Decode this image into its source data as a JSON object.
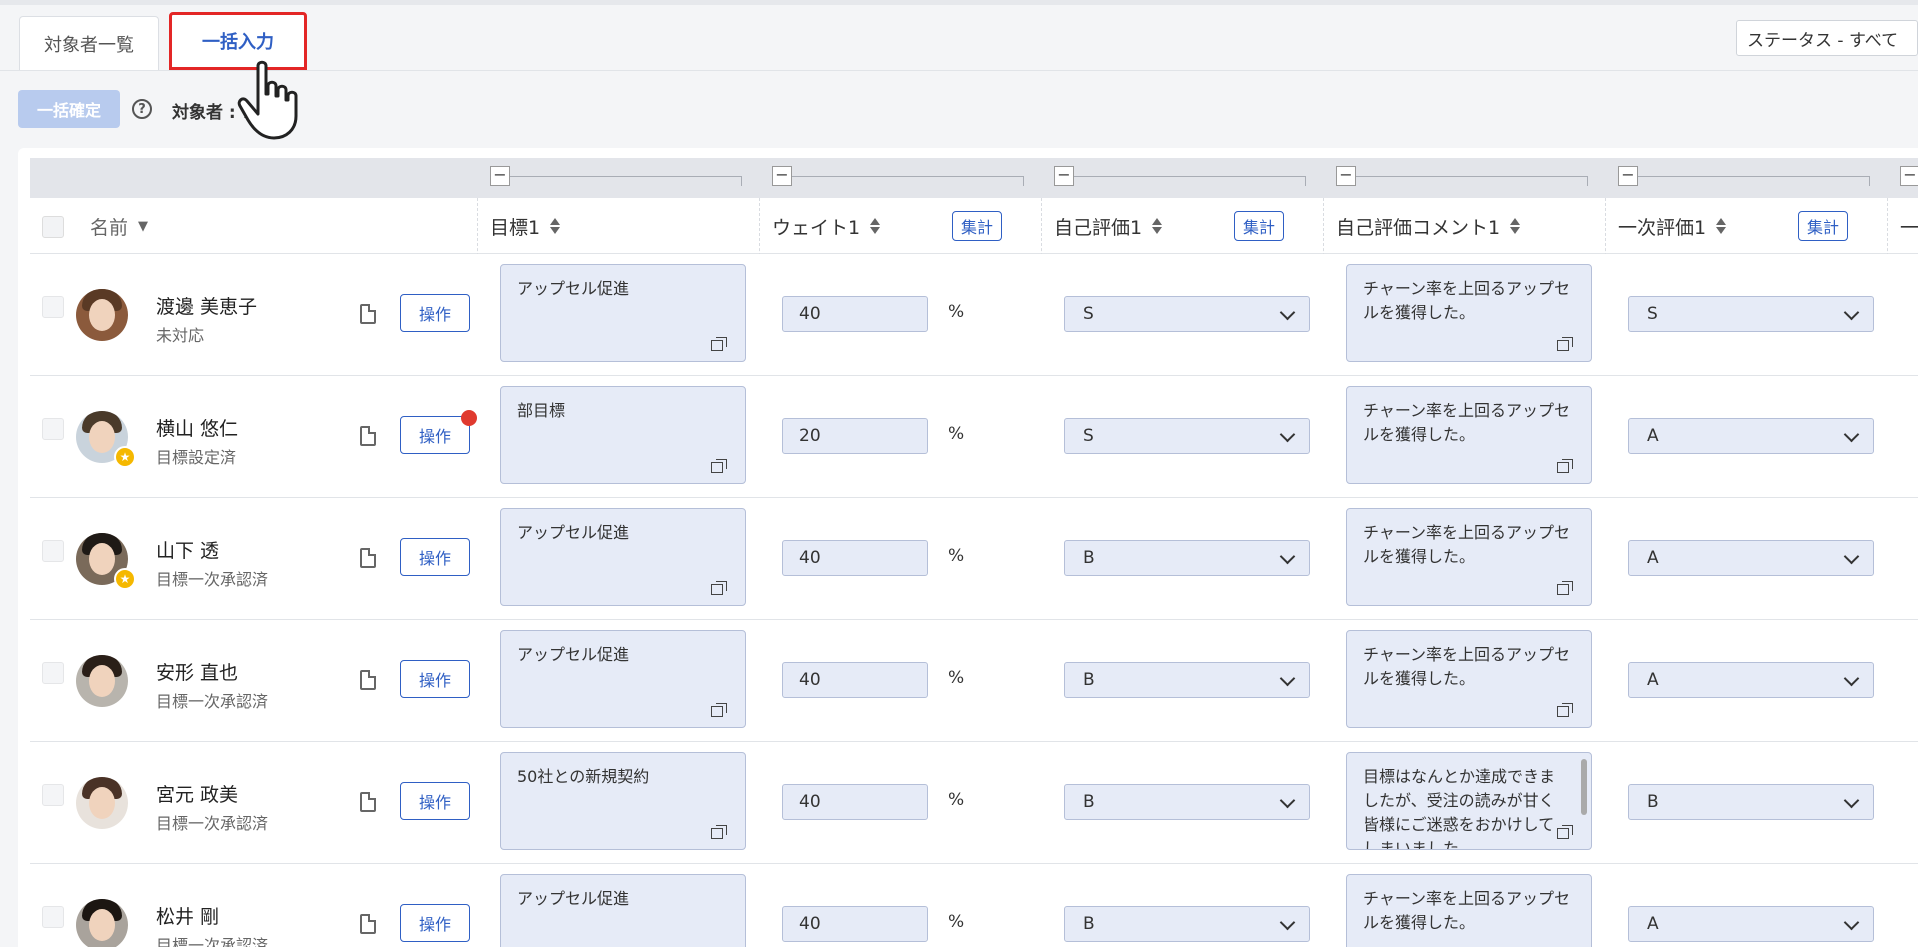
{
  "tabs": [
    {
      "label": "対象者一覧"
    },
    {
      "label": "一括入力"
    }
  ],
  "toolbar": {
    "status_filter": "ステータス - すべて",
    "bulk_confirm_label": "一括確定",
    "target_label": "対象者 : 7"
  },
  "columns": {
    "name": "名前",
    "goal": "目標1",
    "weight": "ウェイト1",
    "self_eval": "自己評価1",
    "self_comment": "自己評価コメント1",
    "first_eval": "一次評価1",
    "sum_label": "集計",
    "next_partial": "一"
  },
  "units": {
    "percent": "%"
  },
  "icons": [
    "help-icon",
    "hand-pointer-icon",
    "sort-icon",
    "document-icon",
    "expand-icon",
    "chevron-down-icon",
    "star-badge-icon"
  ],
  "colors": {
    "accent": "#2f5fc4",
    "highlight_border": "#e32626",
    "field_bg": "#e6ebf7",
    "notification": "#e03a2f",
    "badge": "#f5b800"
  },
  "rows": [
    {
      "name": "渡邊 美恵子",
      "status": "未対応",
      "op_label": "操作",
      "goal": "アップセル促進",
      "weight": "40",
      "self_eval": "S",
      "self_comment": "チャーン率を上回るアップセルを獲得した。",
      "first_eval": "S"
    },
    {
      "name": "横山 悠仁",
      "status": "目標設定済",
      "op_label": "操作",
      "goal": "部目標",
      "weight": "20",
      "self_eval": "S",
      "self_comment": "チャーン率を上回るアップセルを獲得した。",
      "first_eval": "A"
    },
    {
      "name": "山下 透",
      "status": "目標一次承認済",
      "op_label": "操作",
      "goal": "アップセル促進",
      "weight": "40",
      "self_eval": "B",
      "self_comment": "チャーン率を上回るアップセルを獲得した。",
      "first_eval": "A"
    },
    {
      "name": "安形 直也",
      "status": "目標一次承認済",
      "op_label": "操作",
      "goal": "アップセル促進",
      "weight": "40",
      "self_eval": "B",
      "self_comment": "チャーン率を上回るアップセルを獲得した。",
      "first_eval": "A"
    },
    {
      "name": "宮元 政美",
      "status": "目標一次承認済",
      "op_label": "操作",
      "goal": "50社との新規契約",
      "weight": "40",
      "self_eval": "B",
      "self_comment": "目標はなんとか達成できましたが、受注の読みが甘く皆様にご迷惑をおかけしてしまいました。",
      "first_eval": "B"
    },
    {
      "name": "松井 剛",
      "status": "目標一次承認済",
      "op_label": "操作",
      "goal": "アップセル促進",
      "weight": "40",
      "self_eval": "B",
      "self_comment": "チャーン率を上回るアップセルを獲得した。",
      "first_eval": "A"
    }
  ]
}
